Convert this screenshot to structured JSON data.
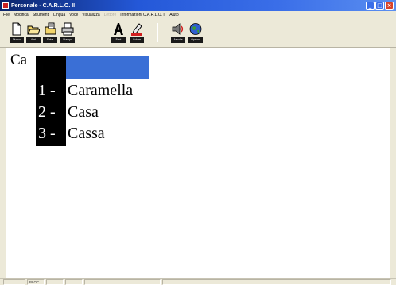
{
  "window": {
    "title": "Personale - C.A.R.L.O. II"
  },
  "menu": {
    "items": [
      {
        "label": "File",
        "disabled": false
      },
      {
        "label": "Modifica",
        "disabled": false
      },
      {
        "label": "Strumenti",
        "disabled": false
      },
      {
        "label": "Lingua",
        "disabled": false
      },
      {
        "label": "Voce",
        "disabled": false
      },
      {
        "label": "Visualizza",
        "disabled": false
      },
      {
        "label": "Lettore",
        "disabled": true
      },
      {
        "label": "Informazioni C.A.R.L.O. II",
        "disabled": false
      },
      {
        "label": "Aiuto",
        "disabled": false
      }
    ]
  },
  "toolbar": {
    "new_label": "Nuovo",
    "open_label": "Apri",
    "save_label": "Salva",
    "print_label": "Stampa",
    "font_label": "Font",
    "color_label": "Colore",
    "speak_label": "Ascolta",
    "options_label": "Opzioni"
  },
  "document": {
    "typed_text": "Ca"
  },
  "prediction": {
    "items": [
      {
        "num": "1 -",
        "word": "Caramella"
      },
      {
        "num": "2 -",
        "word": "Casa"
      },
      {
        "num": "3 -",
        "word": "Cassa"
      }
    ]
  },
  "status": {
    "mode_label": "BLOC"
  }
}
